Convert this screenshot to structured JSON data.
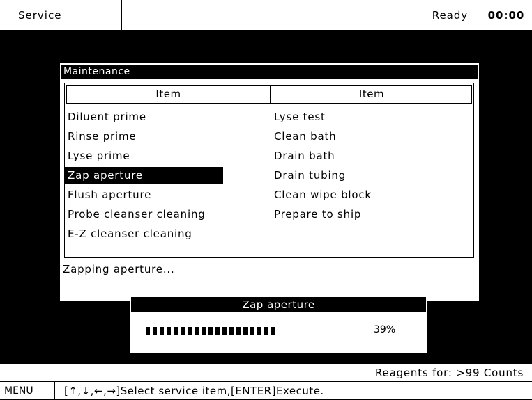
{
  "header": {
    "title": "Service",
    "status": "Ready",
    "clock": "00:00"
  },
  "dialog": {
    "title": "Maintenance",
    "columns": [
      "Item",
      "Item"
    ],
    "left_items": [
      "Diluent prime",
      "Rinse prime",
      "Lyse prime",
      "Zap aperture",
      "Flush aperture",
      "Probe cleanser cleaning",
      "E-Z cleanser cleaning"
    ],
    "right_items": [
      "Lyse test",
      "Clean bath",
      "Drain bath",
      "Drain tubing",
      "Clean wipe block",
      "Prepare to ship"
    ],
    "selected_item": "Zap aperture",
    "status_message": "Zapping aperture..."
  },
  "progress": {
    "title": "Zap aperture",
    "value_percent": 39,
    "label": "39%"
  },
  "footer": {
    "reagents": "Reagents for: >99 Counts",
    "menu": "MENU",
    "hint": "[↑,↓,←,→]Select service item,[ENTER]Execute."
  }
}
